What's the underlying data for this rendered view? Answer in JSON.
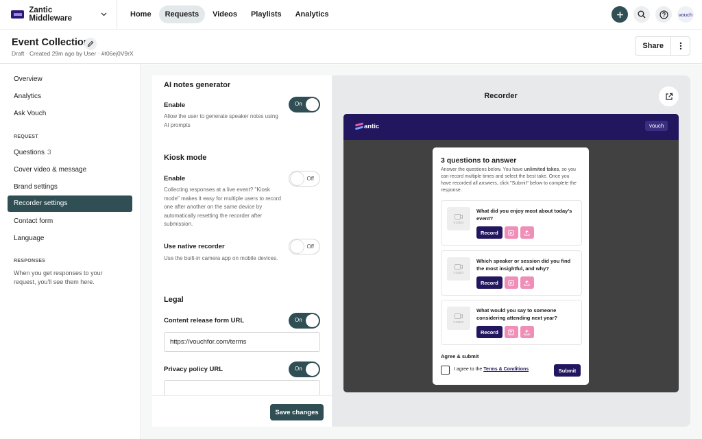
{
  "nav": {
    "org_name": "Zantic Middleware",
    "links": [
      "Home",
      "Requests",
      "Videos",
      "Playlists",
      "Analytics"
    ],
    "active_link": "Requests",
    "avatar_text": "vouch"
  },
  "header": {
    "title": "Event Collection",
    "subtitle": "Draft · Created 29m ago by User · #t06ej0V9rX",
    "share_label": "Share"
  },
  "sidebar": {
    "items": [
      {
        "label": "Overview"
      },
      {
        "label": "Analytics"
      },
      {
        "label": "Ask Vouch"
      }
    ],
    "request_heading": "REQUEST",
    "request_items": [
      {
        "label": "Questions",
        "count": "3"
      },
      {
        "label": "Cover video & message"
      },
      {
        "label": "Brand settings"
      },
      {
        "label": "Recorder settings",
        "active": true
      },
      {
        "label": "Contact form"
      },
      {
        "label": "Language"
      }
    ],
    "responses_heading": "RESPONSES",
    "responses_note": "When you get responses to your request, you'll see them here."
  },
  "settings": {
    "ai_notes": {
      "title": "AI notes generator",
      "enable_label": "Enable",
      "enable_desc": "Allow the user to generate speaker notes using AI prompts",
      "toggle": "On"
    },
    "kiosk": {
      "title": "Kiosk mode",
      "enable_label": "Enable",
      "enable_desc": "Collecting responses at a live event? \"Kiosk mode\" makes it easy for multiple users to record one after another on the same device by automatically resetting the recorder after submission.",
      "toggle": "Off",
      "native_label": "Use native recorder",
      "native_desc": "Use the built-in camera app on mobile devices.",
      "native_toggle": "Off"
    },
    "legal": {
      "title": "Legal",
      "release_label": "Content release form URL",
      "release_toggle": "On",
      "release_value": "https://vouchfor.com/terms",
      "privacy_label": "Privacy policy URL",
      "privacy_toggle": "On",
      "privacy_value": ""
    },
    "save_label": "Save changes"
  },
  "preview": {
    "title": "Recorder",
    "brand_name": "antic",
    "badge": "vouch",
    "card_title": "3 questions to answer",
    "card_desc_pre": "Answer the questions below. You have ",
    "card_desc_bold": "unlimited takes",
    "card_desc_post": ", so you can record multiple times and select the best take. Once you have recorded all answers, click \"Submit\" below to complete the response.",
    "thumb_label": "VIDEO",
    "record_label": "Record",
    "questions": [
      "What did you enjoy most about today's event?",
      "Which speaker or session did you find the most insightful, and why?",
      "What would you say to someone considering attending next year?"
    ],
    "agree_title": "Agree & submit",
    "agree_text": "I agree to the ",
    "agree_link": "Terms & Conditions",
    "submit_label": "Submit"
  },
  "colors": {
    "primary": "#2f4f55",
    "recorder_brand": "#22165f",
    "pink_action": "#ef8fb7"
  },
  "icons": [
    "chevron-down-icon",
    "plus-icon",
    "search-icon",
    "help-icon",
    "pencil-icon",
    "more-vertical-icon",
    "external-link-icon",
    "camera-icon",
    "notes-icon",
    "upload-icon"
  ]
}
